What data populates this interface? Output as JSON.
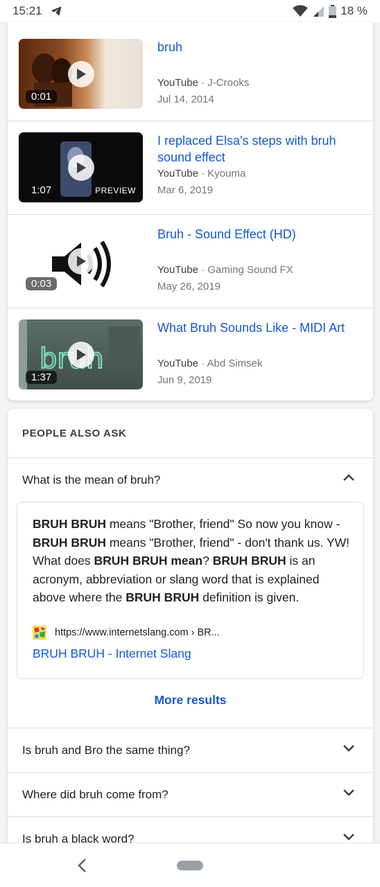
{
  "status_bar": {
    "time": "15:21",
    "battery": "18 %"
  },
  "videos": [
    {
      "title": "bruh",
      "source": "YouTube",
      "channel": "J-Crooks",
      "date": "Jul 14, 2014",
      "duration": "0:01",
      "badge": ""
    },
    {
      "title": "I replaced Elsa's steps with bruh sound effect",
      "source": "YouTube",
      "channel": "Kyouma",
      "date": "Mar 6, 2019",
      "duration": "1:07",
      "badge": "PREVIEW"
    },
    {
      "title": "Bruh - Sound Effect (HD)",
      "source": "YouTube",
      "channel": "Gaming Sound FX",
      "date": "May 26, 2019",
      "duration": "0:03",
      "badge": ""
    },
    {
      "title": "What Bruh Sounds Like - MIDI Art",
      "source": "YouTube",
      "channel": "Abd Simsek",
      "date": "Jun 9, 2019",
      "duration": "1:37",
      "badge": "",
      "thumb_text": "bruh"
    }
  ],
  "people_also_ask": {
    "heading": "PEOPLE ALSO ASK",
    "expanded_question": "What is the mean of bruh?",
    "answer_parts": [
      {
        "t": "BRUH BRUH",
        "b": true
      },
      {
        "t": " means \"Brother, friend\" So now you know - ",
        "b": false
      },
      {
        "t": "BRUH BRUH",
        "b": true
      },
      {
        "t": " means \"Brother, friend\" - don't thank us. YW! What does ",
        "b": false
      },
      {
        "t": "BRUH BRUH mean",
        "b": true
      },
      {
        "t": "? ",
        "b": false
      },
      {
        "t": "BRUH BRUH",
        "b": true
      },
      {
        "t": " is an acronym, abbreviation or slang word that is explained above where the ",
        "b": false
      },
      {
        "t": "BRUH BRUH",
        "b": true
      },
      {
        "t": " definition is given.",
        "b": false
      }
    ],
    "source_url": "https://www.internetslang.com › BR...",
    "source_title": "BRUH BRUH - Internet Slang",
    "more_results": "More results",
    "other_questions": [
      "Is bruh and Bro the same thing?",
      "Where did bruh come from?",
      "Is bruh a black word?"
    ]
  },
  "colors": {
    "link": "#1558d6",
    "divider": "#dadce0",
    "muted": "#70757a"
  }
}
